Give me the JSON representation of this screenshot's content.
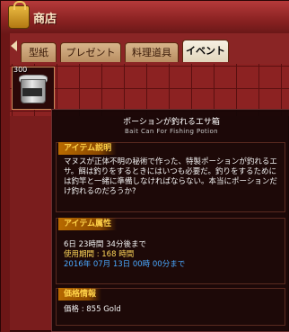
{
  "window": {
    "title": "商店",
    "colors": {
      "frame": "#7a1d1d",
      "title_text": "#ffe9c8",
      "section_header": "#ffd248",
      "period": "#ffd75a",
      "date": "#4aa8ff"
    }
  },
  "tabs": [
    {
      "label": "型紙",
      "active": false
    },
    {
      "label": "プレゼント",
      "active": false
    },
    {
      "label": "料理道具",
      "active": false
    },
    {
      "label": "イベント",
      "active": true
    }
  ],
  "inventory": {
    "items": [
      {
        "icon": "bait-can-icon",
        "count": "300"
      }
    ]
  },
  "tooltip": {
    "title": "ポーションが釣れるエサ箱",
    "subtitle": "Bait Can For Fishing Potion",
    "description_header": "アイテム説明",
    "description": "マヌスが正体不明の秘術で作った、特製ポーションが釣れるエサ。餌は釣りをするときにはいつも必要だ。釣りをするためには釣竿と一緒に準備しなければならない。本当にポーションだけ釣れるのだろうか?",
    "attributes_header": "アイテム属性",
    "remaining": "6日 23時間 34分後まで",
    "period_label": "使用期間 : 168 時間",
    "expiry_date": "2016年 07月 13日 00時 00分まで",
    "price_header": "価格情報",
    "price": "価格 : 855 Gold"
  }
}
